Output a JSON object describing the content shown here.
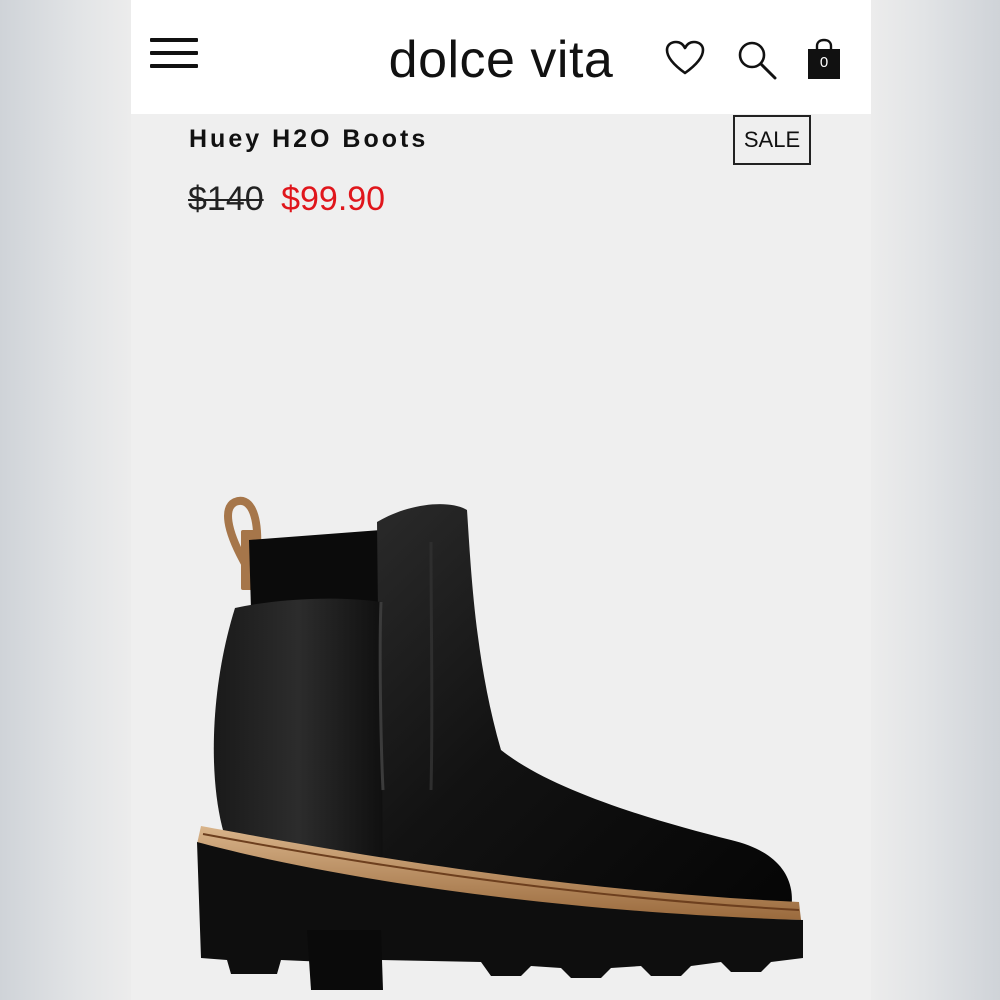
{
  "header": {
    "brand": "dolce vita",
    "cart_count": "0"
  },
  "product": {
    "title": "Huey H2O Boots",
    "badge": "SALE",
    "price_original": "$140",
    "price_sale": "$99.90"
  },
  "colors": {
    "sale_price": "#e0161c",
    "page_background": "#efefef"
  },
  "icons": [
    "menu-icon",
    "heart-icon",
    "search-icon",
    "shopping-bag-icon"
  ]
}
